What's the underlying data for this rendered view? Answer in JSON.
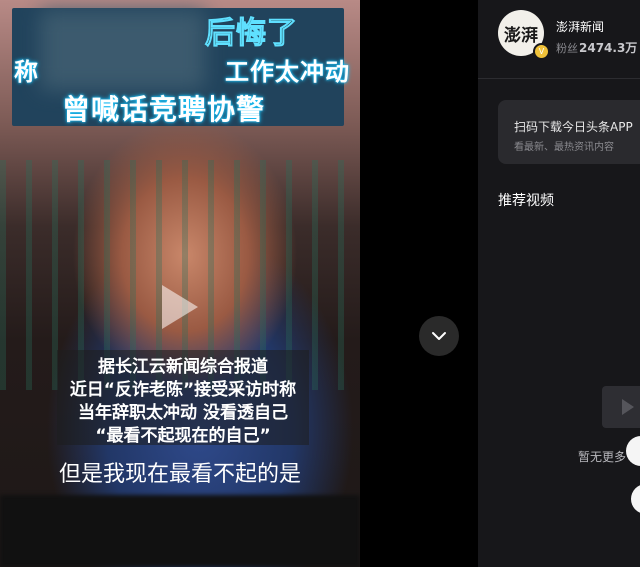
{
  "video": {
    "title_line1": "后悔了",
    "title_line2_left": "称",
    "title_line2_right": "工作太冲动",
    "title_line3": "曾喊话竞聘协警",
    "info_lines": [
      "据长江云新闻综合报道",
      "近日“反诈老陈”接受采访时称",
      "当年辞职太冲动 没看透自己",
      "“最看不起现在的自己”"
    ],
    "subtitle": "但是我现在最看不起的是"
  },
  "author": {
    "avatar_text": "澎湃",
    "name": "澎湃新闻",
    "followers_label": "粉丝",
    "followers_count": "2474.3万"
  },
  "download_card": {
    "title": "扫码下载今日头条APP",
    "subtitle": "看最新、最热资讯内容"
  },
  "recommend": {
    "title": "推荐视频",
    "empty_text": "暂无更多"
  },
  "icons": {
    "collapse": "chevron-down-icon",
    "play": "play-icon",
    "verified": "verified-badge-icon"
  },
  "colors": {
    "caption_glow": "#19c6ff",
    "sidebar_bg": "#17171a",
    "verified": "#f0c23a"
  }
}
